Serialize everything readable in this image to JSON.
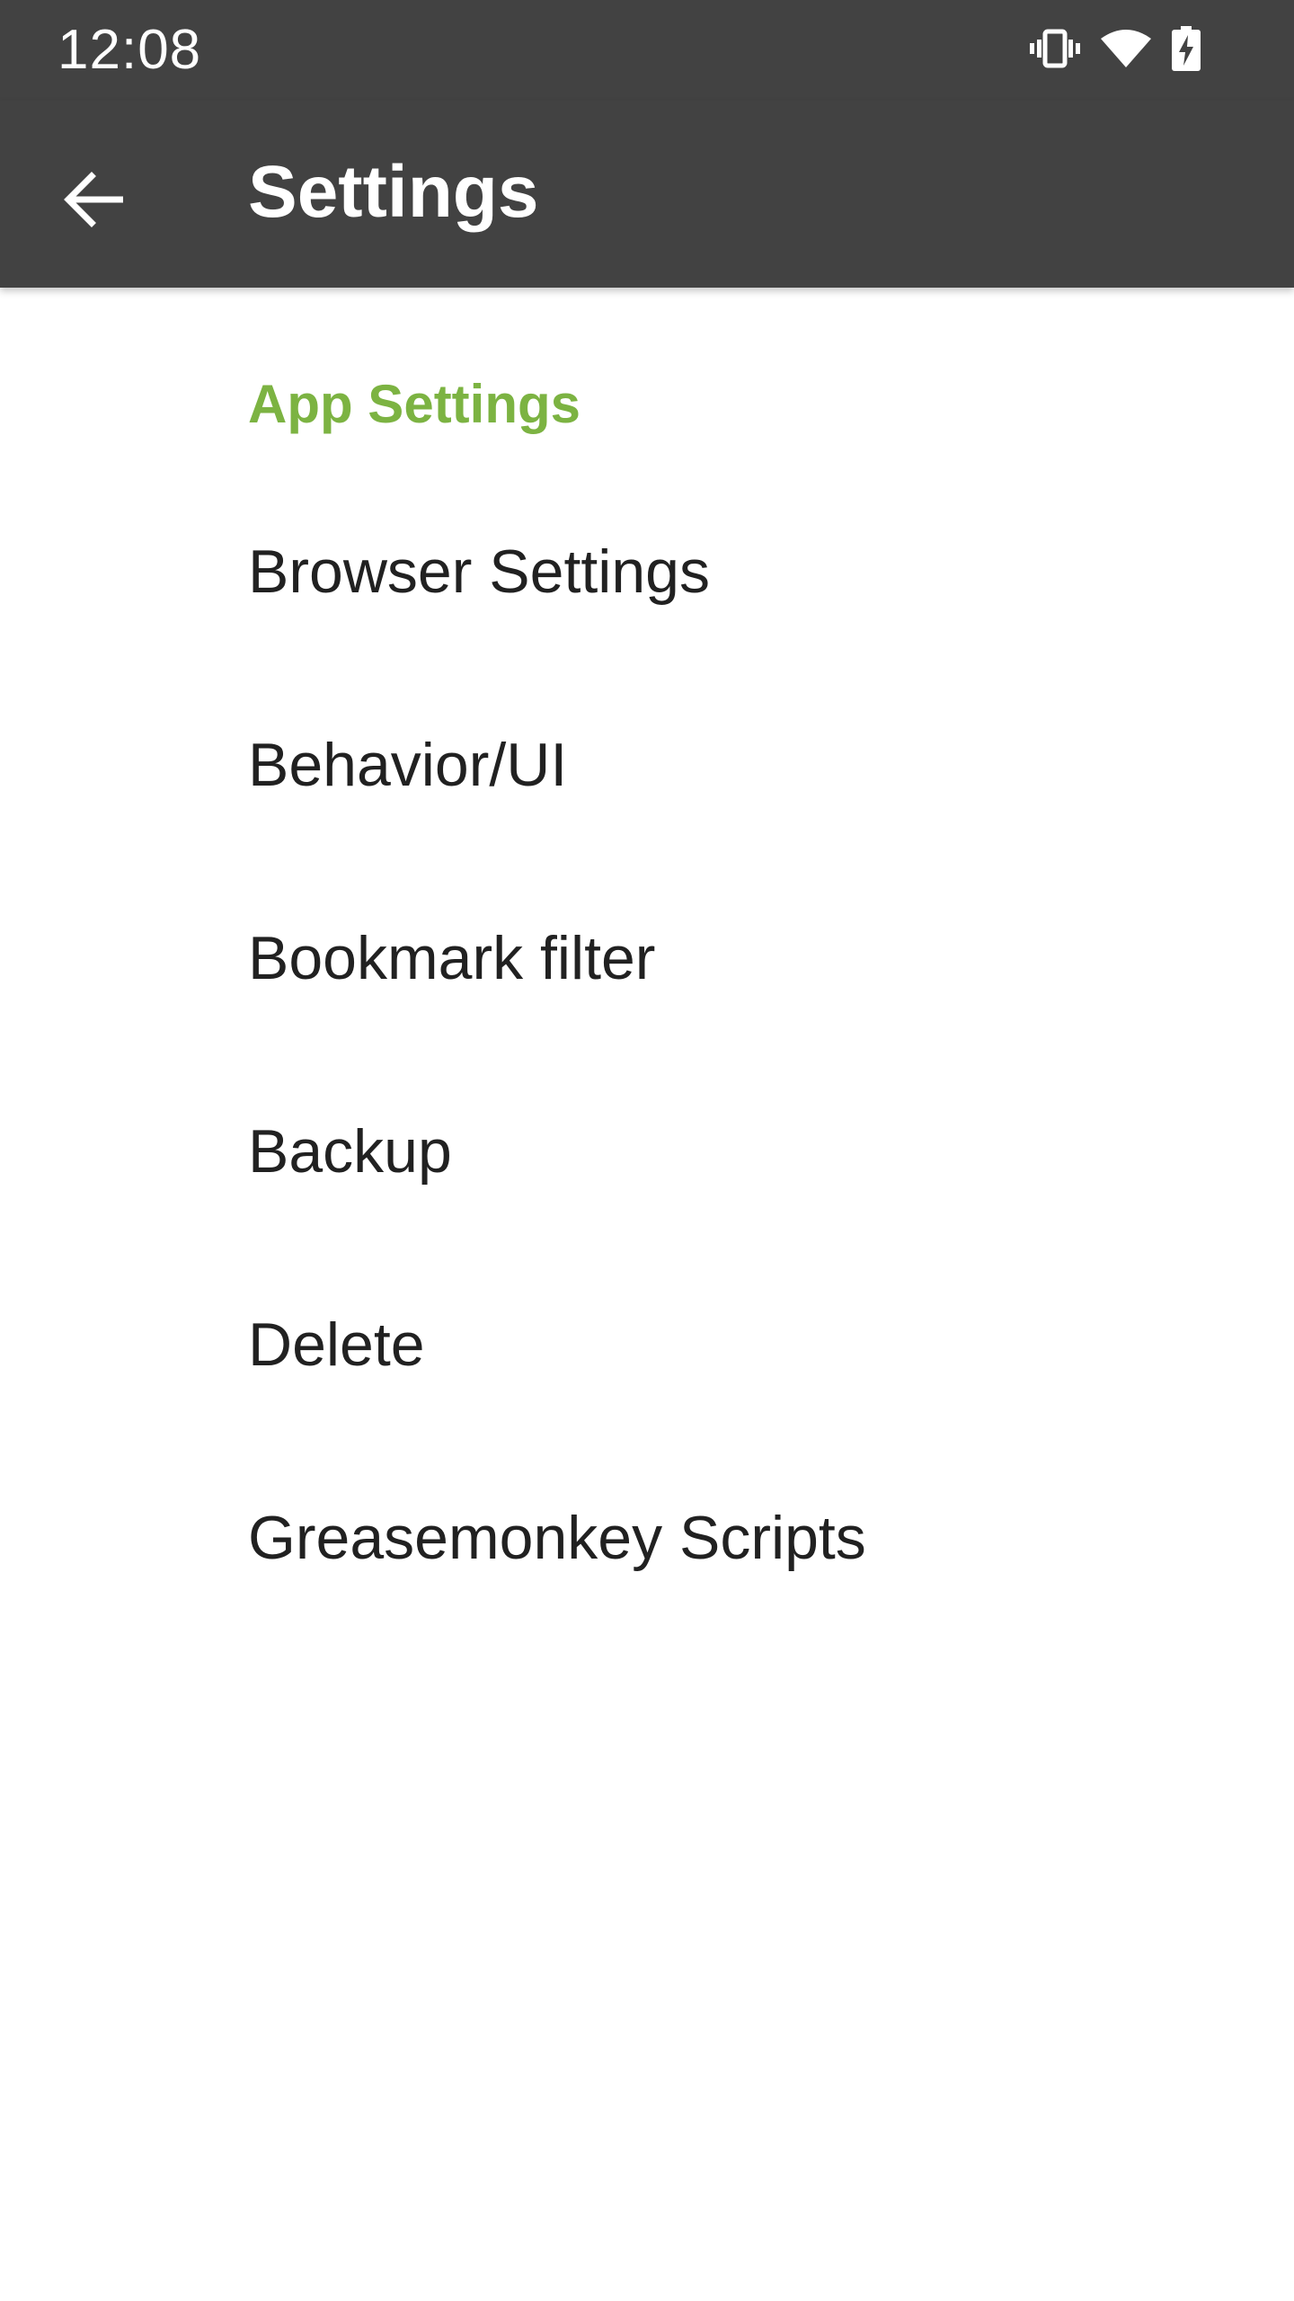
{
  "status_bar": {
    "time": "12:08",
    "icons": [
      "vibrate-icon",
      "wifi-icon",
      "battery-charging-icon"
    ]
  },
  "app_bar": {
    "back_icon": "arrow-back-icon",
    "title": "Settings",
    "background": "#424242"
  },
  "preferences": {
    "category": "App Settings",
    "category_color": "#7cb342",
    "items": [
      {
        "label": "Browser Settings"
      },
      {
        "label": "Behavior/UI"
      },
      {
        "label": "Bookmark filter"
      },
      {
        "label": "Backup"
      },
      {
        "label": "Delete"
      },
      {
        "label": "Greasemonkey Scripts"
      }
    ]
  }
}
